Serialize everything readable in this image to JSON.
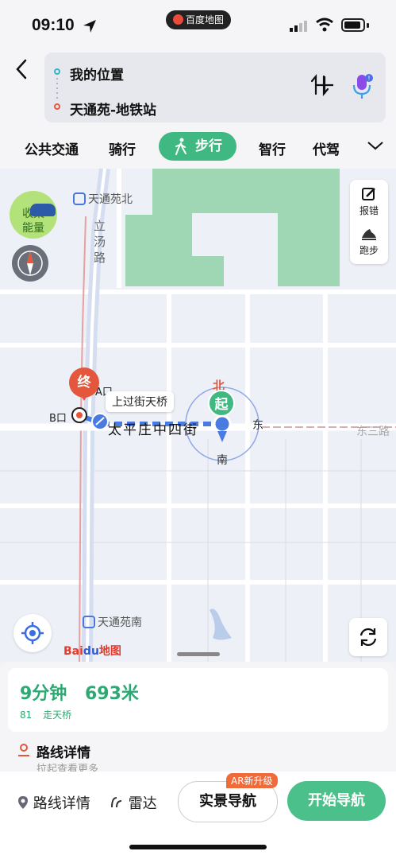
{
  "status": {
    "time": "09:10",
    "app_pill": "百度地图"
  },
  "route": {
    "from": "我的位置",
    "to": "天通苑-地铁站"
  },
  "tabs": [
    {
      "label": "公共交通"
    },
    {
      "label": "骑行"
    },
    {
      "label": "步行",
      "active": true
    },
    {
      "label": "智行"
    },
    {
      "label": "代驾"
    }
  ],
  "map": {
    "labels": {
      "tiantongyuan_north": "天通苑北",
      "litang_road": "立汤路",
      "tiantongyuan_south": "天通苑南",
      "taipingzhuang_st": "太平庄中四街",
      "dongsan_road": "东三路",
      "a_exit": "A口",
      "b_exit": "B口",
      "overpass_tip": "上过街天桥",
      "end_marker": "终",
      "start_marker": "起",
      "north": "北",
      "south": "南",
      "east": "东"
    },
    "collect_energy": "收集能量",
    "tools": {
      "report": "报错",
      "run": "跑步"
    },
    "logo": {
      "bai": "Bai",
      "du": "du",
      "map": "地图"
    }
  },
  "summary": {
    "duration": "9分钟",
    "distance": "693米",
    "stat_count": "1",
    "stat_label": "走天桥",
    "detail_title": "路线详情",
    "detail_hint": "拉起查看更多"
  },
  "bottom": {
    "route_detail": "路线详情",
    "radar": "雷达",
    "ar_nav": "实景导航",
    "ar_badge": "AR新升级",
    "start_nav": "开始导航"
  },
  "colors": {
    "accent": "#3fb981",
    "end": "#e4573d",
    "route": "#4a7be0"
  }
}
